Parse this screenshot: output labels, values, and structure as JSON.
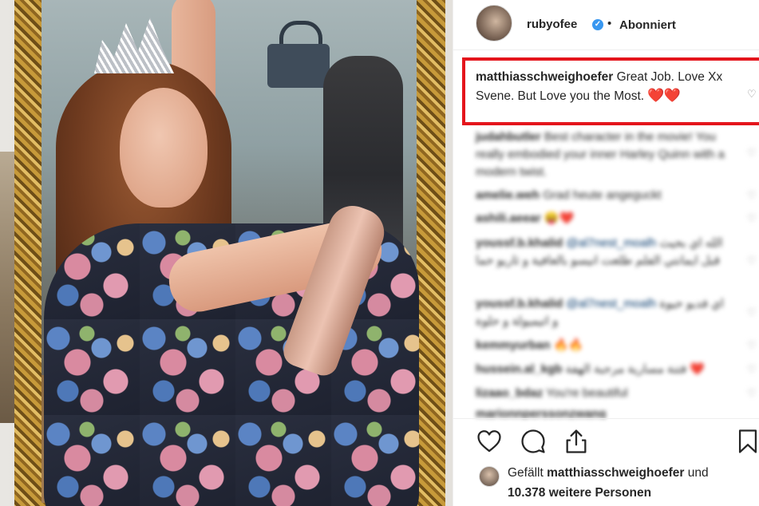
{
  "post": {
    "username": "rubyofee",
    "verified_mark": "✓",
    "separator": "•",
    "follow_status": "Abonniert"
  },
  "highlighted_comment": {
    "user": "matthiasschweighoefer",
    "text": "Great Job. Love Xx Svene. But Love you the Most.",
    "emoji": "❤️❤️"
  },
  "comments": [
    {
      "user": "judahbutler",
      "text": "Best character in the movie! You really embodied your inner Harley Quinn with a modern twist."
    },
    {
      "user": "amelie.weh",
      "text": "Grad heute angeguckt"
    },
    {
      "user": "ashili.aeear",
      "text": "",
      "emoji": "😝❤️"
    },
    {
      "user": "youssf.b.khalid",
      "mention": "@al7nest_moalh",
      "text": "الله اي بحيث قبل ايمانتي الفلم طلعت انيسو بالعافية و ثاريو حما"
    },
    {
      "user": "youssf.b.khalid",
      "mention": "@al7nest_moalh",
      "text": "اي فديو حيوة و اتيميولة و حلوة"
    },
    {
      "user": "kemmyurban",
      "text": "",
      "emoji": "🔥🔥"
    },
    {
      "user": "hussein.al_kgb",
      "text": "فتنة مسارية مرحبة الهفة",
      "emoji": "❤️"
    },
    {
      "user": "lizaao_bdaz",
      "text": "You're beautiful"
    },
    {
      "user": "marionnperssonzwang",
      "text": ""
    }
  ],
  "likes": {
    "prefix": "Gefällt",
    "user": "matthiasschweighoefer",
    "conjunction": "und",
    "others": "10.378 weitere Personen"
  },
  "icons": {
    "like": "heart-outline-icon",
    "comment": "comment-bubble-icon",
    "share": "share-icon",
    "save": "bookmark-icon",
    "comment_like": "small-heart-icon"
  },
  "colors": {
    "highlight_border": "#e4151c",
    "verified": "#3897f0",
    "heart_emoji": "#e0201b",
    "text": "#262626"
  }
}
